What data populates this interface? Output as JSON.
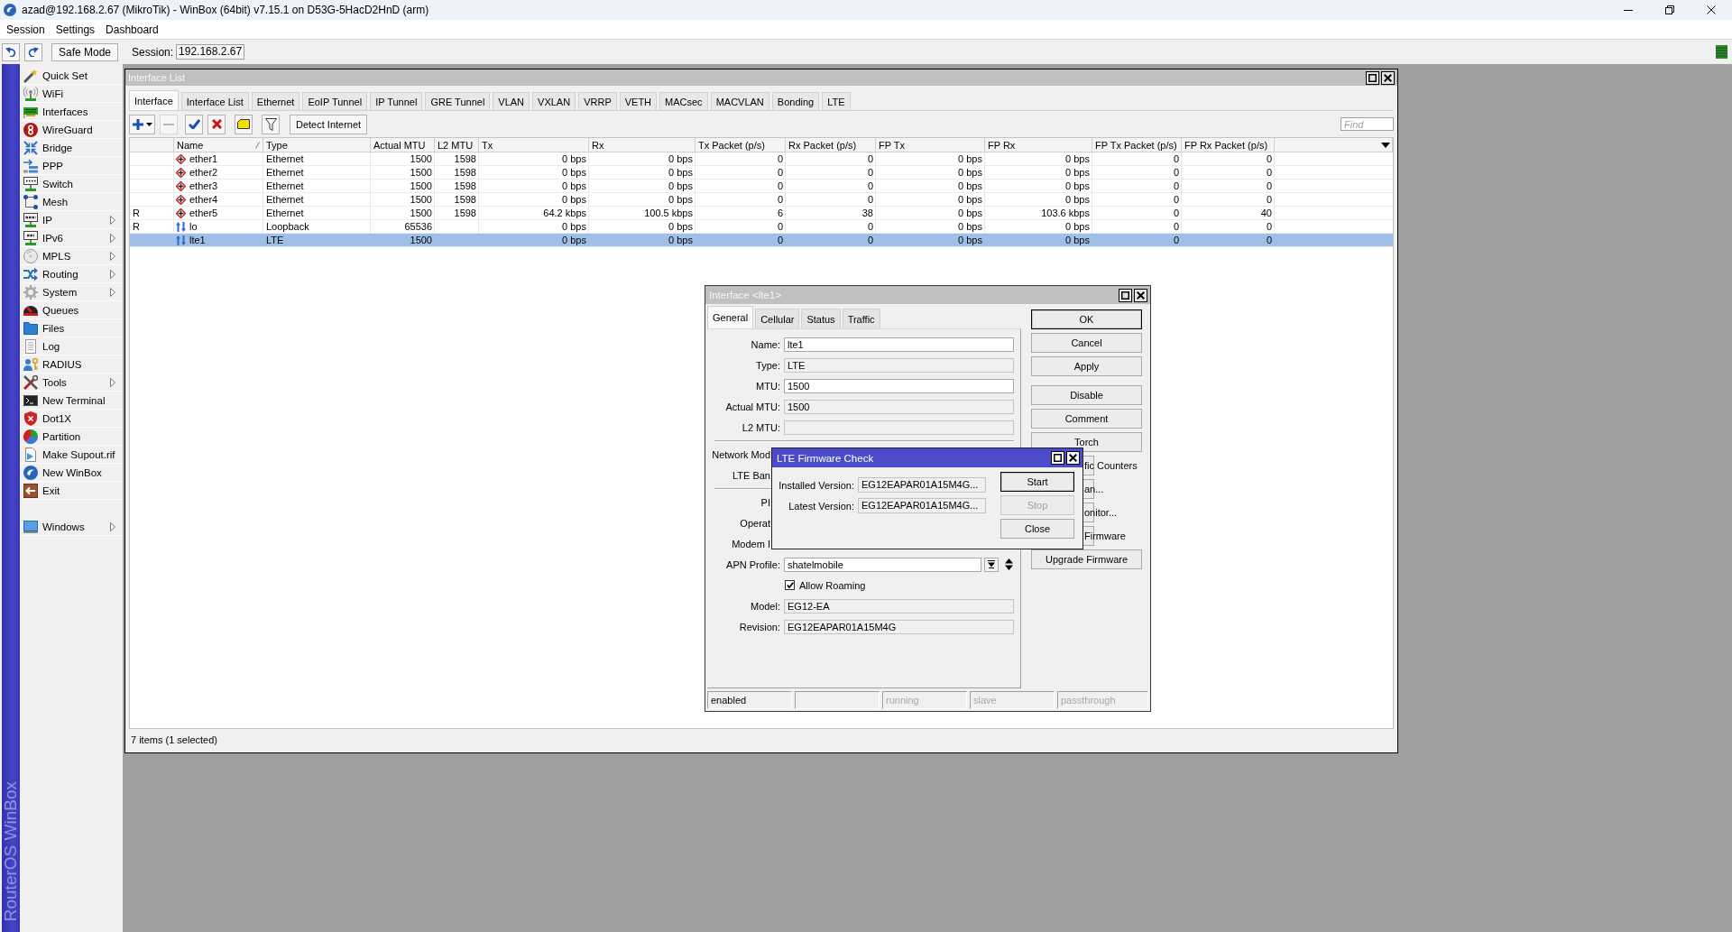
{
  "window": {
    "title": "azad@192.168.2.67 (MikroTik) - WinBox (64bit) v7.15.1 on D53G-5HacD2HnD (arm)"
  },
  "menu_bar": [
    "Session",
    "Settings",
    "Dashboard"
  ],
  "toolbar": {
    "safe_mode": "Safe Mode",
    "session_label": "Session:",
    "session_field": {
      "value": "192.168.2.67"
    }
  },
  "sidebar": {
    "brand": "RouterOS WinBox",
    "items": [
      {
        "label": "Quick Set",
        "submenu": false
      },
      {
        "label": "WiFi",
        "submenu": false
      },
      {
        "label": "Interfaces",
        "submenu": false
      },
      {
        "label": "WireGuard",
        "submenu": false
      },
      {
        "label": "Bridge",
        "submenu": false
      },
      {
        "label": "PPP",
        "submenu": false
      },
      {
        "label": "Switch",
        "submenu": false
      },
      {
        "label": "Mesh",
        "submenu": false
      },
      {
        "label": "IP",
        "submenu": true
      },
      {
        "label": "IPv6",
        "submenu": true
      },
      {
        "label": "MPLS",
        "submenu": true
      },
      {
        "label": "Routing",
        "submenu": true
      },
      {
        "label": "System",
        "submenu": true
      },
      {
        "label": "Queues",
        "submenu": false
      },
      {
        "label": "Files",
        "submenu": false
      },
      {
        "label": "Log",
        "submenu": false
      },
      {
        "label": "RADIUS",
        "submenu": false
      },
      {
        "label": "Tools",
        "submenu": true
      },
      {
        "label": "New Terminal",
        "submenu": false
      },
      {
        "label": "Dot1X",
        "submenu": false
      },
      {
        "label": "Partition",
        "submenu": false
      },
      {
        "label": "Make Supout.rif",
        "submenu": false
      },
      {
        "label": "New WinBox",
        "submenu": false
      },
      {
        "label": "Exit",
        "submenu": false
      }
    ],
    "footer_items": [
      {
        "label": "Windows",
        "submenu": true
      }
    ]
  },
  "interface_list": {
    "title": "Interface List",
    "tabs": [
      {
        "label": "Interface",
        "selected": true
      },
      {
        "label": "Interface List",
        "selected": false
      },
      {
        "label": "Ethernet",
        "selected": false
      },
      {
        "label": "EoIP Tunnel",
        "selected": false
      },
      {
        "label": "IP Tunnel",
        "selected": false
      },
      {
        "label": "GRE Tunnel",
        "selected": false
      },
      {
        "label": "VLAN",
        "selected": false
      },
      {
        "label": "VXLAN",
        "selected": false
      },
      {
        "label": "VRRP",
        "selected": false
      },
      {
        "label": "VETH",
        "selected": false
      },
      {
        "label": "MACsec",
        "selected": false
      },
      {
        "label": "MACVLAN",
        "selected": false
      },
      {
        "label": "Bonding",
        "selected": false
      },
      {
        "label": "LTE",
        "selected": false
      }
    ],
    "toolbar": {
      "buttons": [
        {
          "kind": "add",
          "disabled": false
        },
        {
          "kind": "remove",
          "disabled": true
        },
        {
          "kind": "enable",
          "disabled": false
        },
        {
          "kind": "disable",
          "disabled": false
        },
        {
          "kind": "comment",
          "disabled": false
        },
        {
          "kind": "filter",
          "disabled": false
        }
      ],
      "detect_button": "Detect Internet",
      "find_field": {
        "placeholder": "Find"
      }
    },
    "table": {
      "columns": [
        {
          "label": "Name",
          "sorted": true
        },
        {
          "label": "Type",
          "sorted": false
        },
        {
          "label": "Actual MTU",
          "sorted": false
        },
        {
          "label": "L2 MTU",
          "sorted": false
        },
        {
          "label": "Tx",
          "sorted": false
        },
        {
          "label": "Rx",
          "sorted": false
        },
        {
          "label": "Tx Packet (p/s)",
          "sorted": false
        },
        {
          "label": "Rx Packet (p/s)",
          "sorted": false
        },
        {
          "label": "FP Tx",
          "sorted": false
        },
        {
          "label": "FP Rx",
          "sorted": false
        },
        {
          "label": "FP Tx Packet (p/s)",
          "sorted": false
        },
        {
          "label": "FP Rx Packet (p/s)",
          "sorted": false
        }
      ],
      "rows": [
        {
          "kind": "ethernet",
          "selected": false,
          "name": "ether1",
          "type": "Ethernet",
          "actual_mtu": "1500",
          "l2_mtu": "1598",
          "tx": "0 bps",
          "rx": "0 bps",
          "tx_packet": "0",
          "rx_packet": "0",
          "fp_tx": "0 bps",
          "fp_rx": "0 bps",
          "fp_tx_packet": "0",
          "fp_rx_packet": "0"
        },
        {
          "kind": "ethernet",
          "selected": false,
          "name": "ether2",
          "type": "Ethernet",
          "actual_mtu": "1500",
          "l2_mtu": "1598",
          "tx": "0 bps",
          "rx": "0 bps",
          "tx_packet": "0",
          "rx_packet": "0",
          "fp_tx": "0 bps",
          "fp_rx": "0 bps",
          "fp_tx_packet": "0",
          "fp_rx_packet": "0"
        },
        {
          "kind": "ethernet",
          "selected": false,
          "name": "ether3",
          "type": "Ethernet",
          "actual_mtu": "1500",
          "l2_mtu": "1598",
          "tx": "0 bps",
          "rx": "0 bps",
          "tx_packet": "0",
          "rx_packet": "0",
          "fp_tx": "0 bps",
          "fp_rx": "0 bps",
          "fp_tx_packet": "0",
          "fp_rx_packet": "0"
        },
        {
          "kind": "ethernet",
          "selected": false,
          "name": "ether4",
          "type": "Ethernet",
          "actual_mtu": "1500",
          "l2_mtu": "1598",
          "tx": "0 bps",
          "rx": "0 bps",
          "tx_packet": "0",
          "rx_packet": "0",
          "fp_tx": "0 bps",
          "fp_rx": "0 bps",
          "fp_tx_packet": "0",
          "fp_rx_packet": "0"
        },
        {
          "kind": "ethernet",
          "selected": false,
          "flag": "R",
          "name": "ether5",
          "type": "Ethernet",
          "actual_mtu": "1500",
          "l2_mtu": "1598",
          "tx": "64.2 kbps",
          "rx": "100.5 kbps",
          "tx_packet": "6",
          "rx_packet": "38",
          "fp_tx": "0 bps",
          "fp_rx": "103.6 kbps",
          "fp_tx_packet": "0",
          "fp_rx_packet": "40"
        },
        {
          "kind": "loopback",
          "selected": false,
          "flag": "R",
          "name": "lo",
          "type": "Loopback",
          "actual_mtu": "65536",
          "tx": "0 bps",
          "rx": "0 bps",
          "tx_packet": "0",
          "rx_packet": "0",
          "fp_tx": "0 bps",
          "fp_rx": "0 bps",
          "fp_tx_packet": "0",
          "fp_rx_packet": "0"
        },
        {
          "kind": "lte",
          "selected": true,
          "name": "lte1",
          "type": "LTE",
          "actual_mtu": "1500",
          "tx": "0 bps",
          "rx": "0 bps",
          "tx_packet": "0",
          "rx_packet": "0",
          "fp_tx": "0 bps",
          "fp_rx": "0 bps",
          "fp_tx_packet": "0",
          "fp_rx_packet": "0"
        }
      ]
    },
    "status": "7 items (1 selected)"
  },
  "interface_dialog": {
    "title": "Interface <lte1>",
    "tabs": [
      {
        "label": "General",
        "selected": true
      },
      {
        "label": "Cellular",
        "selected": false
      },
      {
        "label": "Status",
        "selected": false
      },
      {
        "label": "Traffic",
        "selected": false
      }
    ],
    "form_groups": [
      [
        {
          "kind": "field",
          "label": "Name:",
          "value": "lte1",
          "read_only": false
        },
        {
          "kind": "field",
          "label": "Type:",
          "value": "LTE",
          "read_only": true
        },
        {
          "kind": "field",
          "label": "MTU:",
          "value": "1500",
          "read_only": false
        },
        {
          "kind": "field",
          "label": "Actual MTU:",
          "value": "1500",
          "read_only": true
        },
        {
          "kind": "field",
          "label": "L2 MTU:",
          "read_only": true
        }
      ],
      [
        {
          "kind": "covered",
          "label": "Network Mod"
        },
        {
          "kind": "covered",
          "label": "LTE Ban"
        }
      ],
      [
        {
          "kind": "covered",
          "label": "PI"
        },
        {
          "kind": "covered",
          "label": "Operat"
        },
        {
          "kind": "covered",
          "label": "Modem I"
        },
        {
          "kind": "combo",
          "label": "APN Profile:",
          "value": "shatelmobile"
        },
        {
          "kind": "checkbox",
          "label": "Allow Roaming",
          "checked": true
        },
        {
          "kind": "field",
          "label": "Model:",
          "value": "EG12-EA",
          "read_only": true
        },
        {
          "kind": "field",
          "label": "Revision:",
          "value": "EG12EAPAR01A15M4G",
          "read_only": true
        }
      ]
    ],
    "button_groups": [
      [
        {
          "label": "OK",
          "default": true,
          "covered": false
        },
        {
          "label": "Cancel",
          "default": false,
          "covered": false
        },
        {
          "label": "Apply",
          "default": false,
          "covered": false
        }
      ],
      [
        {
          "label": "Disable",
          "default": false,
          "covered": false
        },
        {
          "label": "Comment",
          "default": false,
          "covered": false
        },
        {
          "label": "Torch",
          "default": false,
          "covered": false
        },
        {
          "label": "fic Counters",
          "default": false,
          "covered": true
        },
        {
          "label": "an...",
          "default": false,
          "covered": true
        },
        {
          "label": "onitor...",
          "default": false,
          "covered": true
        },
        {
          "label": "Firmware",
          "default": false,
          "covered": true
        },
        {
          "label": "Upgrade Firmware",
          "default": false,
          "covered": false
        }
      ]
    ],
    "status_bar": [
      {
        "text": "enabled",
        "active": true
      },
      {
        "text": "running",
        "active": false
      },
      {
        "text": "slave",
        "active": false
      },
      {
        "text": "passthrough",
        "active": false
      }
    ]
  },
  "firmware_dialog": {
    "title": "LTE Firmware Check",
    "fields": [
      {
        "label": "Installed Version:",
        "value": "EG12EAPAR01A15M4G...",
        "read_only": true
      },
      {
        "label": "Latest Version:",
        "value": "EG12EAPAR01A15M4G...",
        "read_only": true
      }
    ],
    "buttons": [
      {
        "label": "Start",
        "default": true,
        "disabled": false
      },
      {
        "label": "Stop",
        "default": false,
        "disabled": true
      },
      {
        "label": "Close",
        "default": false,
        "disabled": false
      }
    ]
  }
}
